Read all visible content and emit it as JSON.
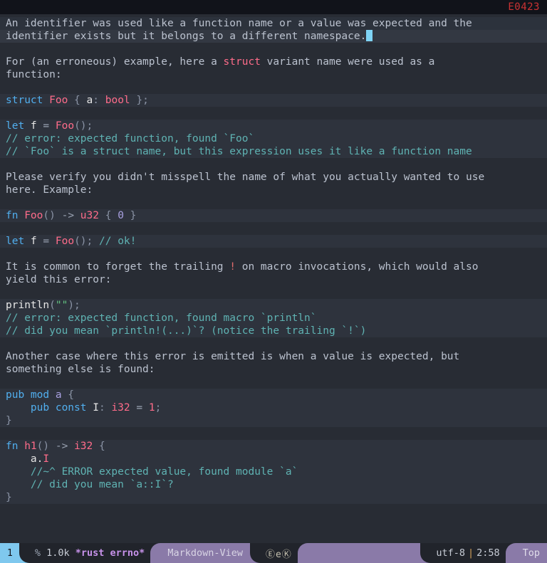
{
  "header": {
    "error_code": "E0423"
  },
  "buffer": {
    "lines": [
      {
        "id": "l1",
        "hl": "region",
        "segs": [
          {
            "c": "txt",
            "t": "An identifier was used like a function name or a value was expected and the"
          }
        ]
      },
      {
        "id": "l2",
        "hl": "current",
        "segs": [
          {
            "c": "txt",
            "t": "identifier exists but it belongs to a different namespace."
          },
          {
            "c": "cursor",
            "t": " "
          }
        ]
      },
      {
        "id": "l3",
        "hl": "none",
        "segs": []
      },
      {
        "id": "l4",
        "hl": "none",
        "segs": [
          {
            "c": "txt",
            "t": "For (an erroneous) example, here a "
          },
          {
            "c": "type",
            "t": "struct"
          },
          {
            "c": "txt",
            "t": " variant name were used as a"
          }
        ]
      },
      {
        "id": "l5",
        "hl": "none",
        "segs": [
          {
            "c": "txt",
            "t": "function:"
          }
        ]
      },
      {
        "id": "l6",
        "hl": "none",
        "segs": []
      },
      {
        "id": "l7",
        "hl": "code",
        "segs": [
          {
            "c": "kw",
            "t": "struct"
          },
          {
            "c": "txt",
            "t": " "
          },
          {
            "c": "type",
            "t": "Foo"
          },
          {
            "c": "punc",
            "t": " { "
          },
          {
            "c": "white",
            "t": "a"
          },
          {
            "c": "punc",
            "t": ": "
          },
          {
            "c": "type",
            "t": "bool"
          },
          {
            "c": "punc",
            "t": " };"
          }
        ]
      },
      {
        "id": "l8",
        "hl": "none",
        "segs": []
      },
      {
        "id": "l9",
        "hl": "code",
        "segs": [
          {
            "c": "kw",
            "t": "let"
          },
          {
            "c": "white",
            "t": " f "
          },
          {
            "c": "op",
            "t": "="
          },
          {
            "c": "txt",
            "t": " "
          },
          {
            "c": "fn",
            "t": "Foo"
          },
          {
            "c": "punc",
            "t": "();"
          }
        ]
      },
      {
        "id": "l10",
        "hl": "code",
        "segs": [
          {
            "c": "cmt",
            "t": "// error: expected function, found `Foo`"
          }
        ]
      },
      {
        "id": "l11",
        "hl": "code",
        "segs": [
          {
            "c": "cmt",
            "t": "// `Foo` is a struct name, but this expression uses it like a function name"
          }
        ]
      },
      {
        "id": "l12",
        "hl": "none",
        "segs": []
      },
      {
        "id": "l13",
        "hl": "none",
        "segs": [
          {
            "c": "txt",
            "t": "Please verify you didn't misspell the name of what you actually wanted to use"
          }
        ]
      },
      {
        "id": "l14",
        "hl": "none",
        "segs": [
          {
            "c": "txt",
            "t": "here. Example:"
          }
        ]
      },
      {
        "id": "l15",
        "hl": "none",
        "segs": []
      },
      {
        "id": "l16",
        "hl": "code",
        "segs": [
          {
            "c": "kw",
            "t": "fn"
          },
          {
            "c": "txt",
            "t": " "
          },
          {
            "c": "fn",
            "t": "Foo"
          },
          {
            "c": "punc",
            "t": "()"
          },
          {
            "c": "op",
            "t": " -> "
          },
          {
            "c": "type",
            "t": "u32"
          },
          {
            "c": "punc",
            "t": " { "
          },
          {
            "c": "num",
            "t": "0"
          },
          {
            "c": "punc",
            "t": " }"
          }
        ]
      },
      {
        "id": "l17",
        "hl": "none",
        "segs": []
      },
      {
        "id": "l18",
        "hl": "code",
        "segs": [
          {
            "c": "kw",
            "t": "let"
          },
          {
            "c": "white",
            "t": " f "
          },
          {
            "c": "op",
            "t": "="
          },
          {
            "c": "txt",
            "t": " "
          },
          {
            "c": "fn",
            "t": "Foo"
          },
          {
            "c": "punc",
            "t": "(); "
          },
          {
            "c": "cmt",
            "t": "// ok!"
          }
        ]
      },
      {
        "id": "l19",
        "hl": "none",
        "segs": []
      },
      {
        "id": "l20",
        "hl": "none",
        "segs": [
          {
            "c": "txt",
            "t": "It is common to forget the trailing "
          },
          {
            "c": "bang",
            "t": "!"
          },
          {
            "c": "txt",
            "t": " on macro invocations, which would also"
          }
        ]
      },
      {
        "id": "l21",
        "hl": "none",
        "segs": [
          {
            "c": "txt",
            "t": "yield this error:"
          }
        ]
      },
      {
        "id": "l22",
        "hl": "none",
        "segs": []
      },
      {
        "id": "l23",
        "hl": "code",
        "segs": [
          {
            "c": "white",
            "t": "println"
          },
          {
            "c": "punc",
            "t": "("
          },
          {
            "c": "str",
            "t": "\"\""
          },
          {
            "c": "punc",
            "t": ");"
          }
        ]
      },
      {
        "id": "l24",
        "hl": "code",
        "segs": [
          {
            "c": "cmt",
            "t": "// error: expected function, found macro `println`"
          }
        ]
      },
      {
        "id": "l25",
        "hl": "code",
        "segs": [
          {
            "c": "cmt",
            "t": "// did you mean `println!(...)`? (notice the trailing `!`)"
          }
        ]
      },
      {
        "id": "l26",
        "hl": "none",
        "segs": []
      },
      {
        "id": "l27",
        "hl": "none",
        "segs": [
          {
            "c": "txt",
            "t": "Another case where this error is emitted is when a value is expected, but"
          }
        ]
      },
      {
        "id": "l28",
        "hl": "none",
        "segs": [
          {
            "c": "txt",
            "t": "something else is found:"
          }
        ]
      },
      {
        "id": "l29",
        "hl": "none",
        "segs": []
      },
      {
        "id": "l30",
        "hl": "code",
        "segs": [
          {
            "c": "kw",
            "t": "pub mod"
          },
          {
            "c": "txt",
            "t": " "
          },
          {
            "c": "mod",
            "t": "a"
          },
          {
            "c": "punc",
            "t": " {"
          }
        ]
      },
      {
        "id": "l31",
        "hl": "code",
        "segs": [
          {
            "c": "kw",
            "t": "    pub const"
          },
          {
            "c": "white",
            "t": " I"
          },
          {
            "c": "punc",
            "t": ": "
          },
          {
            "c": "type",
            "t": "i32"
          },
          {
            "c": "op",
            "t": " = "
          },
          {
            "c": "type",
            "t": "1"
          },
          {
            "c": "punc",
            "t": ";"
          }
        ]
      },
      {
        "id": "l32",
        "hl": "code",
        "segs": [
          {
            "c": "punc",
            "t": "}"
          }
        ]
      },
      {
        "id": "l33",
        "hl": "none",
        "segs": []
      },
      {
        "id": "l34",
        "hl": "code",
        "segs": [
          {
            "c": "kw",
            "t": "fn"
          },
          {
            "c": "txt",
            "t": " "
          },
          {
            "c": "fn",
            "t": "h1"
          },
          {
            "c": "punc",
            "t": "()"
          },
          {
            "c": "op",
            "t": " -> "
          },
          {
            "c": "type",
            "t": "i32"
          },
          {
            "c": "punc",
            "t": " {"
          }
        ]
      },
      {
        "id": "l35",
        "hl": "code",
        "segs": [
          {
            "c": "white",
            "t": "    a."
          },
          {
            "c": "type",
            "t": "I"
          }
        ]
      },
      {
        "id": "l36",
        "hl": "code",
        "segs": [
          {
            "c": "cmt",
            "t": "    //~^ ERROR expected value, found module `a`"
          }
        ]
      },
      {
        "id": "l37",
        "hl": "code",
        "segs": [
          {
            "c": "cmt",
            "t": "    // did you mean `a::I`?"
          }
        ]
      },
      {
        "id": "l38",
        "hl": "code",
        "segs": [
          {
            "c": "punc",
            "t": "}"
          }
        ]
      }
    ]
  },
  "modeline": {
    "window_number": "1",
    "buffer_percent": "%",
    "buffer_size": "1.0k",
    "buffer_name": "*rust errno*",
    "major_mode": "Markdown-View",
    "minor_modes": "ⒺeⓀ",
    "encoding": "utf-8",
    "separator": "|",
    "position": "2:58",
    "scroll_state": "Top"
  }
}
